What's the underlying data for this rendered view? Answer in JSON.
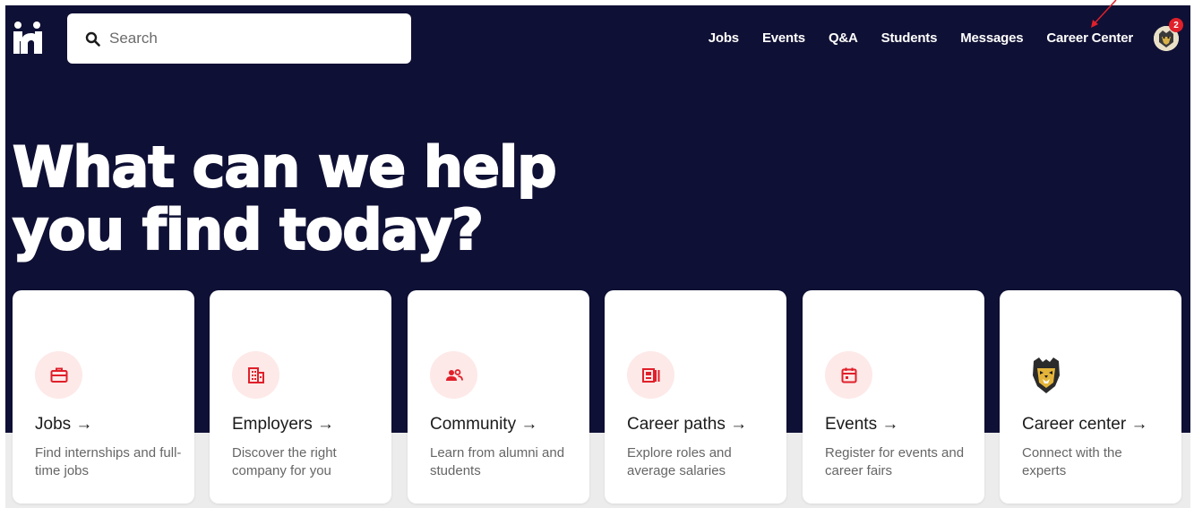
{
  "header": {
    "search_placeholder": "Search",
    "nav": [
      "Jobs",
      "Events",
      "Q&A",
      "Students",
      "Messages",
      "Career Center"
    ],
    "notification_count": "2"
  },
  "hero": {
    "headline_line1": "What can we help",
    "headline_line2": "you find today?"
  },
  "cards": [
    {
      "title": "Jobs →",
      "desc": "Find internships and full-time jobs",
      "icon": "briefcase-icon"
    },
    {
      "title": "Employers →",
      "desc": "Discover the right company for you",
      "icon": "building-icon"
    },
    {
      "title": "Community →",
      "desc": "Learn from alumni and students",
      "icon": "people-icon"
    },
    {
      "title": "Career paths →",
      "desc": "Explore roles and average salaries",
      "icon": "id-card-icon"
    },
    {
      "title": "Events →",
      "desc": "Register for events and career fairs",
      "icon": "calendar-icon"
    },
    {
      "title": "Career center →",
      "desc": "Connect with the experts",
      "icon": "tiger-mascot-icon"
    }
  ],
  "colors": {
    "hero_bg": "#0f1035",
    "accent_red": "#e0202a",
    "icon_circle_bg": "#fde9e8"
  }
}
